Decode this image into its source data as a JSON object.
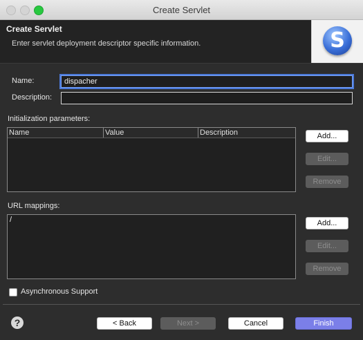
{
  "window": {
    "title": "Create Servlet"
  },
  "banner": {
    "title": "Create Servlet",
    "description": "Enter servlet deployment descriptor specific information.",
    "logo_letter": "S"
  },
  "form": {
    "name_label": "Name:",
    "name_value": "dispacher",
    "description_label": "Description:",
    "description_value": ""
  },
  "init_params": {
    "label": "Initialization parameters:",
    "columns": [
      "Name",
      "Value",
      "Description"
    ],
    "rows": [],
    "add_label": "Add...",
    "edit_label": "Edit...",
    "remove_label": "Remove"
  },
  "url_mappings": {
    "label": "URL mappings:",
    "items": [
      "/"
    ],
    "add_label": "Add...",
    "edit_label": "Edit...",
    "remove_label": "Remove"
  },
  "async_support": {
    "label": "Asynchronous Support",
    "checked": false
  },
  "footer": {
    "help_glyph": "?",
    "back_label": "< Back",
    "next_label": "Next >",
    "cancel_label": "Cancel",
    "finish_label": "Finish"
  },
  "colors": {
    "accent": "#7b7fe8",
    "focus_ring": "#4c7ad9",
    "zoom_button": "#28c840"
  },
  "icons": {
    "help": "question-mark-icon",
    "logo": "servlet-s-icon"
  }
}
